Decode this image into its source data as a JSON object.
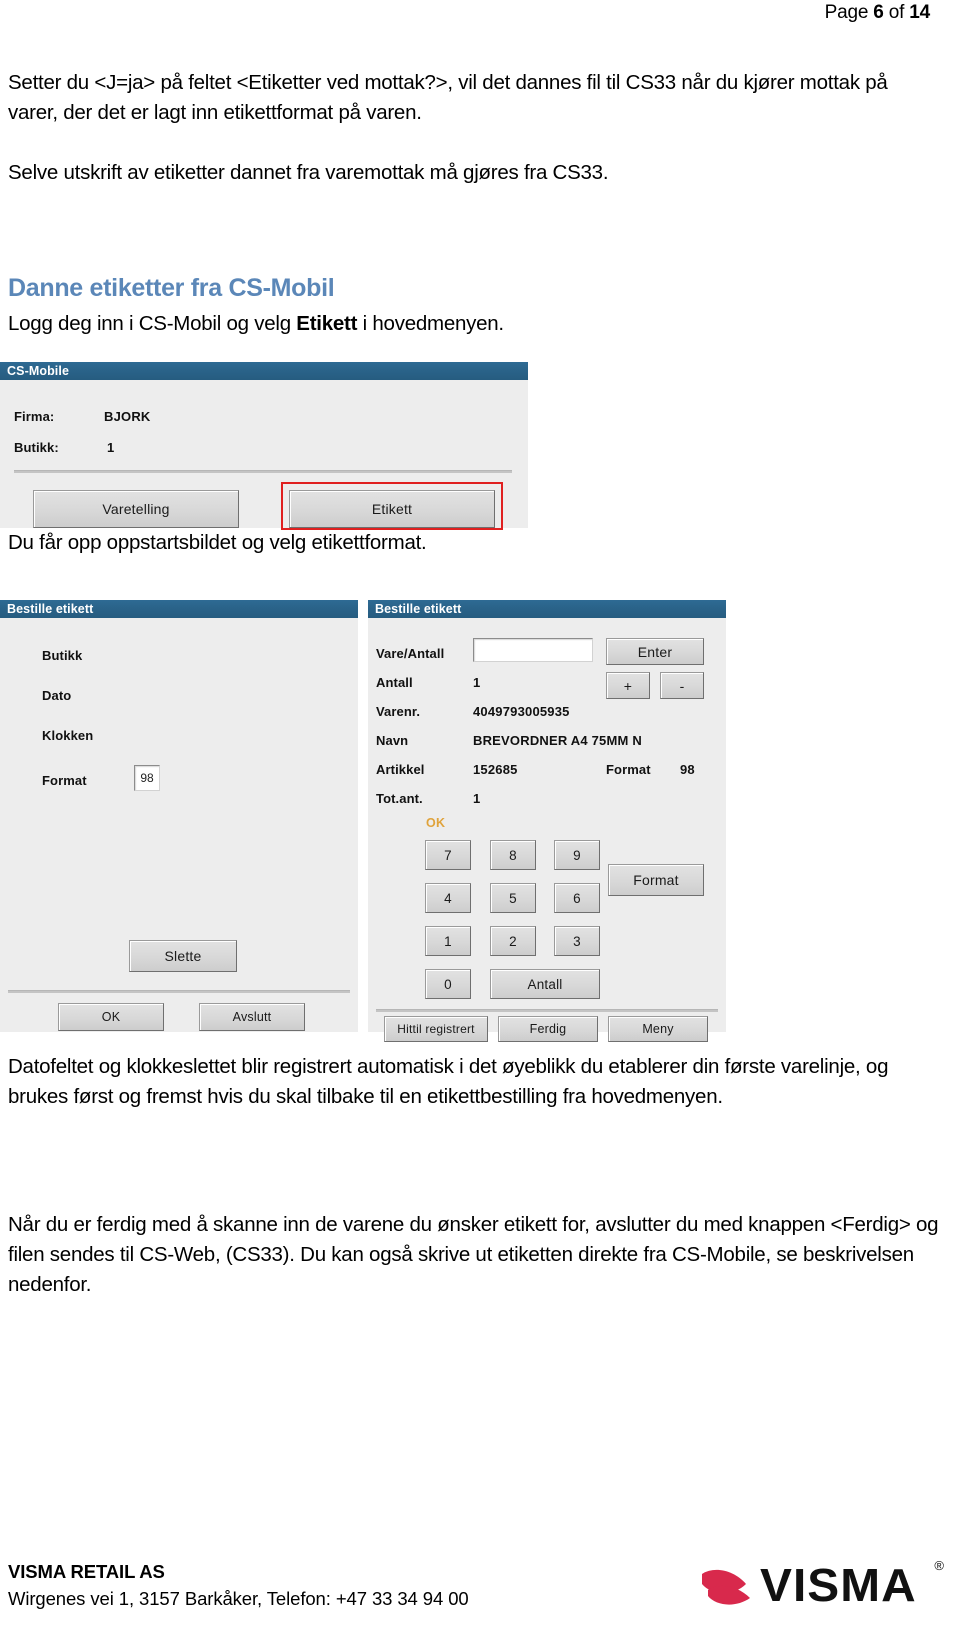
{
  "header": {
    "prefix": "Page ",
    "page_number": "6",
    "middle": " of ",
    "total_pages": "14"
  },
  "intro": {
    "paragraph1": "Setter du <J=ja> på feltet <Etiketter ved mottak?>, vil det dannes fil til CS33 når du kjører mottak på varer, der det er lagt inn etikettformat på varen.",
    "paragraph2": "Selve utskrift av etiketter dannet fra varemottak må gjøres fra CS33."
  },
  "section": {
    "heading": "Danne etiketter fra CS-Mobil",
    "lead_before": "Logg deg inn i CS-Mobil og velg ",
    "lead_bold": "Etikett",
    "lead_after": " i hovedmenyen."
  },
  "csmobile_window": {
    "title": "CS-Mobile",
    "fields": [
      {
        "label": "Firma:",
        "value": "BJORK"
      },
      {
        "label": "Butikk:",
        "value": "1"
      }
    ],
    "buttons": [
      {
        "label": "Varetelling",
        "highlighted": false
      },
      {
        "label": "Etikett",
        "highlighted": true
      }
    ]
  },
  "caption": {
    "text": "Du får opp oppstartsbildet og velg etikettformat."
  },
  "left_panel": {
    "title": "Bestille etikett",
    "labels": [
      "Butikk",
      "Dato",
      "Klokken",
      "Format"
    ],
    "format_value": "98",
    "delete_button": "Slette",
    "footer_buttons": [
      "OK",
      "Avslutt"
    ]
  },
  "right_panel": {
    "title": "Bestille etikett",
    "rows": [
      {
        "label": "Vare/Antall",
        "value": ""
      },
      {
        "label": "Antall",
        "value": "1"
      },
      {
        "label": "Varenr.",
        "value": "4049793005935"
      },
      {
        "label": "Navn",
        "value": "BREVORDNER A4 75MM N"
      },
      {
        "label": "Artikkel",
        "value": "152685"
      },
      {
        "label": "Tot.ant.",
        "value": "1"
      }
    ],
    "input_value": "",
    "enter_button": "Enter",
    "plus_button": "+",
    "minus_button": "-",
    "format_label": "Format",
    "format_value": "98",
    "ok_marker": "OK",
    "keypad": [
      "7",
      "8",
      "9",
      "4",
      "5",
      "6",
      "1",
      "2",
      "3",
      "0"
    ],
    "antall_button": "Antall",
    "format_button": "Format",
    "footer_buttons": [
      "Hittil registrert",
      "Ferdig",
      "Meny"
    ]
  },
  "outro": {
    "paragraph1": "Datofeltet og klokkeslettet blir registrert automatisk i det øyeblikk du etablerer din første varelinje, og brukes først og fremst hvis du skal tilbake til en etikettbestilling fra hovedmenyen.",
    "paragraph2": "Når du er ferdig med å skanne inn de varene du ønsker etikett for, avslutter du med knappen <Ferdig> og filen sendes til CS-Web, (CS33). Du kan også skrive ut etiketten direkte fra CS-Mobile, se beskrivelsen nedenfor."
  },
  "footer": {
    "company": "VISMA RETAIL AS",
    "address": "Wirgenes vei 1, 3157 Barkåker, Telefon: +47 33 34 94 00",
    "logo_text": "VISMA",
    "logo_registered": "®",
    "logo_color": "#d8294c"
  }
}
